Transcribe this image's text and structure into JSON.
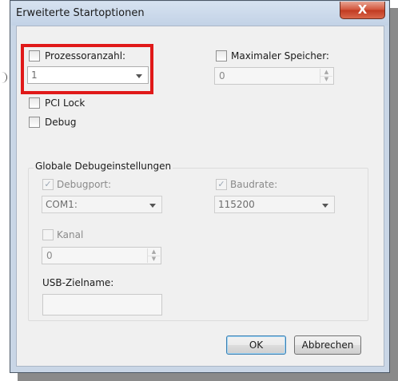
{
  "window": {
    "title": "Erweiterte Startoptionen",
    "close_icon": "close-icon",
    "close_glyph": "X"
  },
  "processor_count": {
    "label": "Prozessoranzahl:",
    "checked": false,
    "value": "1"
  },
  "max_memory": {
    "label": "Maximaler Speicher:",
    "checked": false,
    "value": "0"
  },
  "pci_lock": {
    "label": "PCI Lock",
    "checked": false
  },
  "debug": {
    "label": "Debug",
    "checked": false
  },
  "global_debug": {
    "legend": "Globale Debugeinstellungen",
    "debugport": {
      "label": "Debugport:",
      "checked": true,
      "value": "COM1:"
    },
    "baudrate": {
      "label": "Baudrate:",
      "checked": true,
      "value": "115200"
    },
    "kanal": {
      "label": "Kanal",
      "checked": false,
      "value": "0"
    },
    "usb_target": {
      "label": "USB-Zielname:",
      "value": ""
    }
  },
  "buttons": {
    "ok": "OK",
    "cancel": "Abbrechen"
  },
  "glyphs": {
    "check": "✓",
    "up": "▲",
    "down": "▼"
  },
  "colors": {
    "highlight": "#e01919",
    "close_button": "#c13a21",
    "dialog_bg": "#f0f0f0",
    "title_bar": "#c9d6e6"
  }
}
